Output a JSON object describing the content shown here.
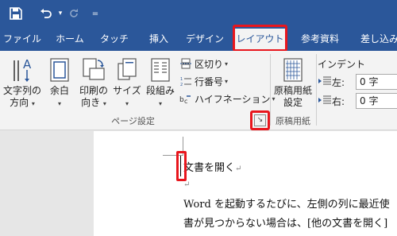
{
  "qat": {
    "undo_dropdown": "▾",
    "customize": "="
  },
  "tabs": [
    {
      "label": "ファイル"
    },
    {
      "label": "ホーム"
    },
    {
      "label": "タッチ"
    },
    {
      "label": "挿入"
    },
    {
      "label": "デザイン"
    },
    {
      "label": "レイアウト"
    },
    {
      "label": "参考資料"
    },
    {
      "label": "差し込み"
    }
  ],
  "ribbon": {
    "text_direction": {
      "line1": "文字列の",
      "line2": "方向"
    },
    "margins": {
      "line1": "余白"
    },
    "orientation": {
      "line1": "印刷の",
      "line2": "向き"
    },
    "size": {
      "line1": "サイズ"
    },
    "columns": {
      "line1": "段組み"
    },
    "breaks": "区切り",
    "line_numbers": "行番号",
    "hyphenation": "ハイフネーション",
    "page_setup_group": "ページ設定",
    "genko": {
      "line1": "原稿用紙",
      "line2": "設定"
    },
    "genko_group": "原稿用紙",
    "launcher": "↘",
    "indent": {
      "title": "インデント",
      "left_label": "左:",
      "left_value": "0 字",
      "right_label": "右:",
      "right_value": "0 字"
    }
  },
  "document": {
    "heading": "文書を開く",
    "pilcrow": "↵",
    "line1": "Word を起動するたびに、左側の列に最近使",
    "line2": "書が見つからない場合は、[他の文書を開く]"
  },
  "colors": {
    "accent": "#2b579a",
    "highlight": "#e8161d"
  }
}
